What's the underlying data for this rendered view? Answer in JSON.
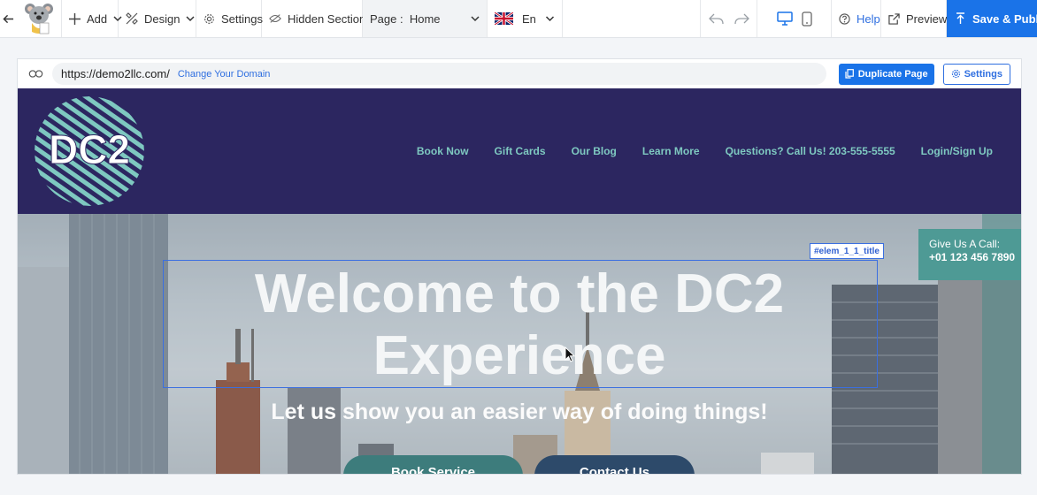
{
  "toolbar": {
    "add_label": "Add",
    "design_label": "Design",
    "settings_label": "Settings",
    "hidden_sections_label": "Hidden Sections",
    "page_prefix": "Page :",
    "page_value": "Home",
    "language": "En",
    "help_label": "Help",
    "preview_label": "Preview",
    "publish_label": "Save & Publish"
  },
  "urlbar": {
    "url": "https://demo2llc.com/",
    "change_domain": "Change Your Domain",
    "duplicate_label": "Duplicate Page",
    "settings_label": "Settings"
  },
  "site": {
    "logo_text": "DC2",
    "nav": [
      "Book Now",
      "Gift Cards",
      "Our Blog",
      "Learn More",
      "Questions? Call Us! 203-555-5555",
      "Login/Sign Up"
    ],
    "hero_title": "Welcome to the DC2 Experience",
    "selection_tag": "#elem_1_1_title",
    "hero_subtitle": "Let us show you an easier way of doing things!",
    "button_primary": "Book Service",
    "button_secondary": "Contact Us",
    "call_label": "Give Us A Call:",
    "call_number": "+01 123 456 7890"
  },
  "colors": {
    "brand_blue": "#1a73e8",
    "header_bg": "#2c2660",
    "nav_text": "#7ec8c0",
    "call_bg": "#4e9a95"
  }
}
